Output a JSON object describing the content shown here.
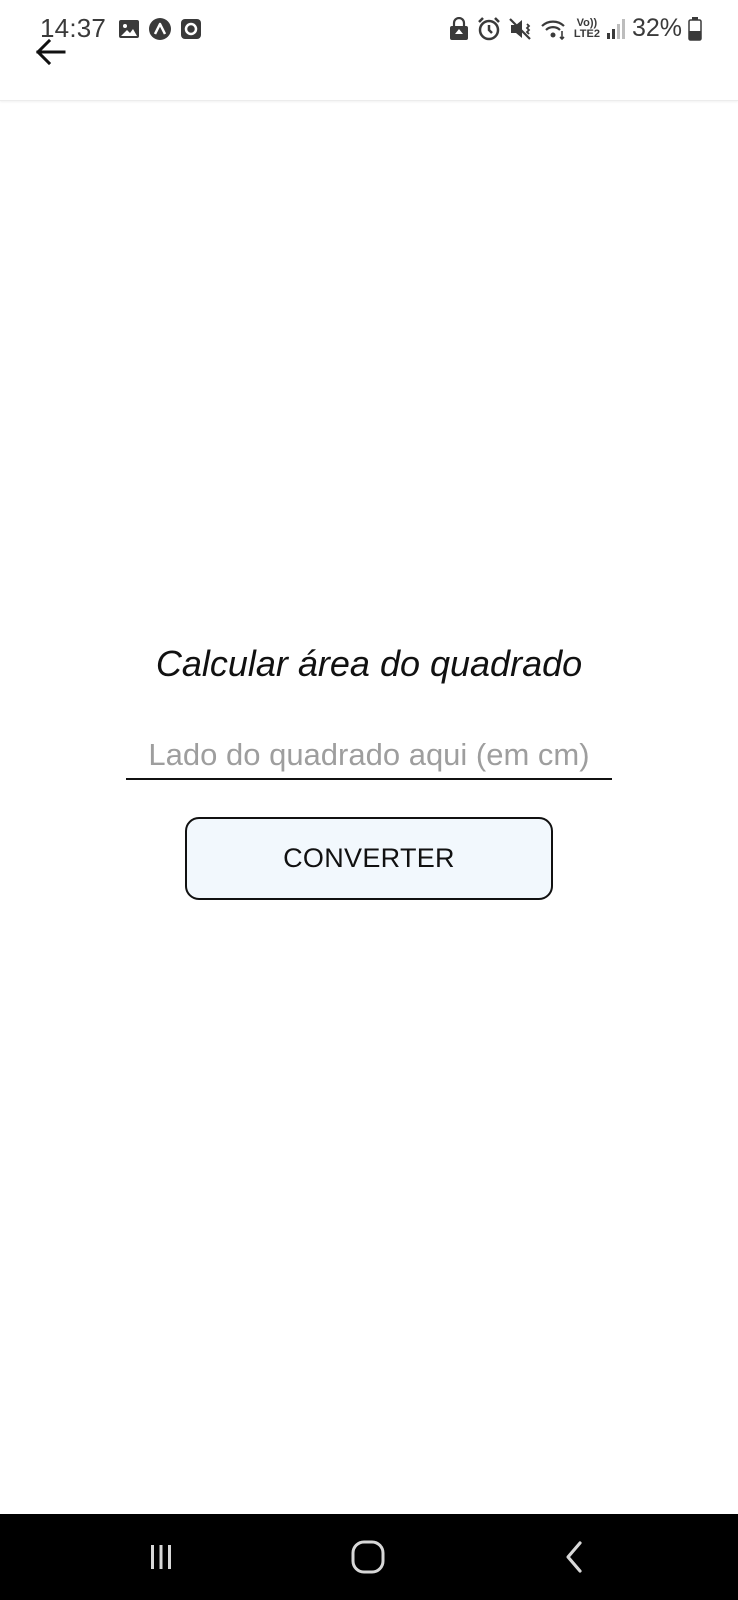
{
  "status_bar": {
    "time": "14:37",
    "battery_percent": "32%",
    "network_top": "Vo))",
    "network_bottom": "LTE2"
  },
  "app_bar": {
    "back_icon": "arrow-left-icon"
  },
  "main": {
    "title": "Calcular área do quadrado",
    "input_placeholder": "Lado do quadrado aqui (em cm)",
    "input_value": "",
    "convert_label": "CONVERTER"
  },
  "colors": {
    "button_bg": "#f2f8fd",
    "text": "#111111",
    "placeholder": "#9e9e9e",
    "nav_bar": "#000000"
  },
  "nav_bar": {
    "icons": [
      "recent-apps-icon",
      "home-icon",
      "back-nav-icon"
    ]
  }
}
